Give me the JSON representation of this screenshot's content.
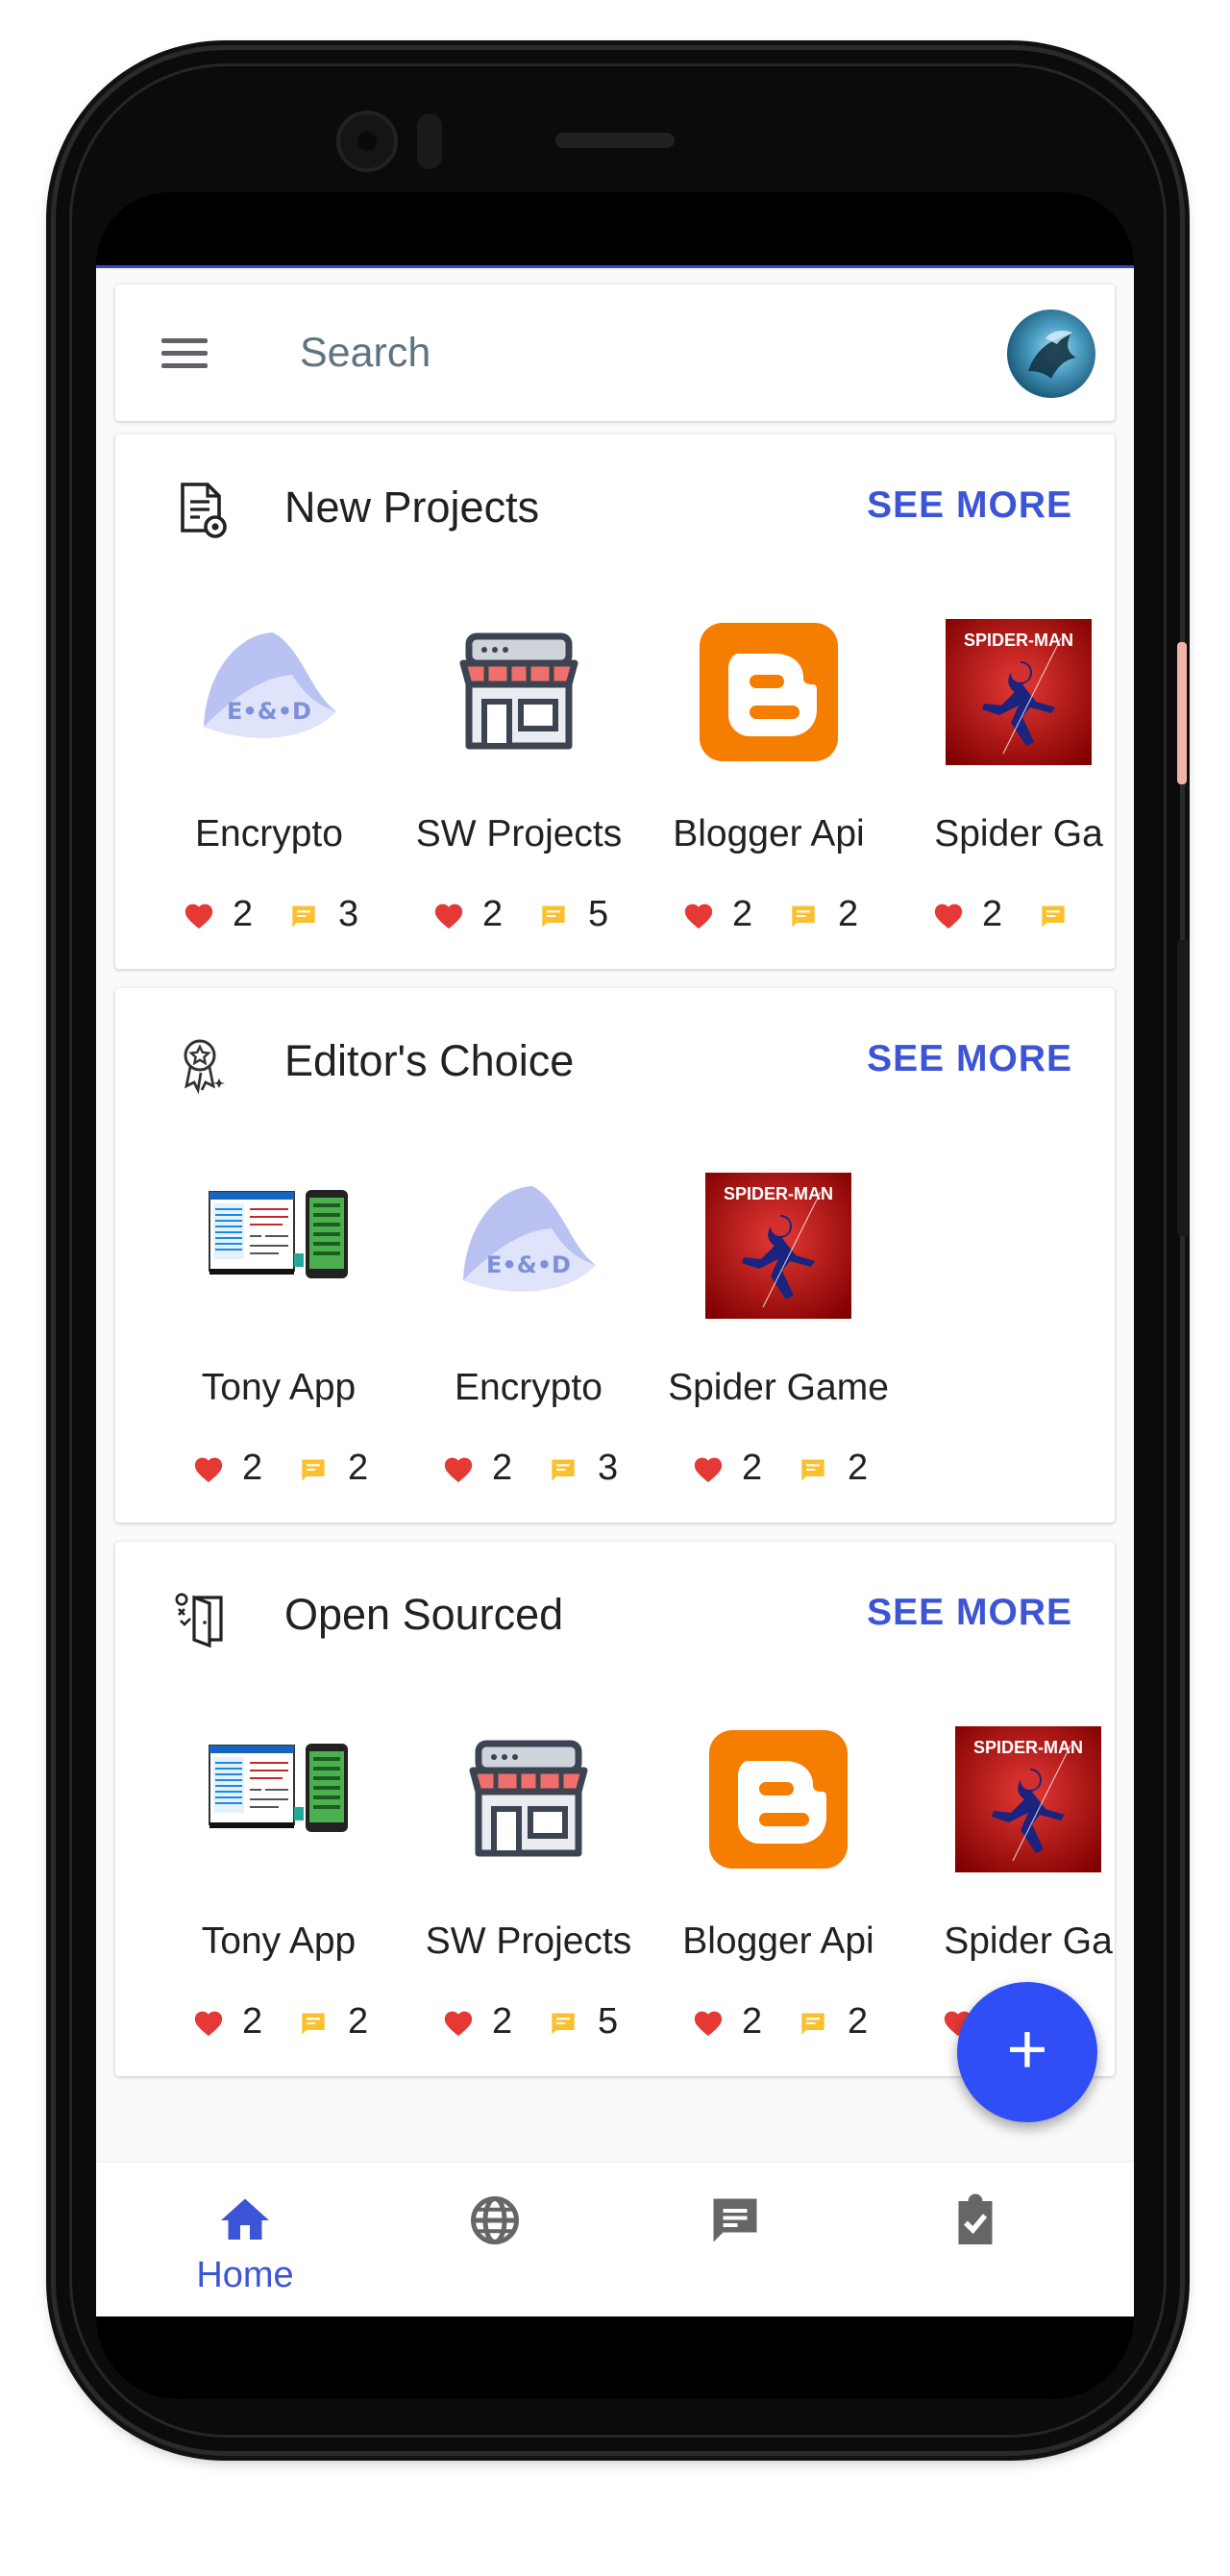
{
  "search": {
    "placeholder": "Search"
  },
  "sections": [
    {
      "title": "New Projects",
      "icon": "document-gear-icon",
      "see_more": "SEE MORE",
      "items": [
        {
          "name": "Encrypto",
          "likes": "2",
          "comments": "3",
          "image": "encrypto-logo"
        },
        {
          "name": "SW Projects",
          "likes": "2",
          "comments": "5",
          "image": "store-icon"
        },
        {
          "name": "Blogger Api",
          "likes": "2",
          "comments": "2",
          "image": "blogger-logo"
        },
        {
          "name": "Spider Ga",
          "likes": "2",
          "comments": "",
          "image": "spiderman-cover"
        }
      ]
    },
    {
      "title": "Editor's Choice",
      "icon": "award-ribbon-icon",
      "see_more": "SEE MORE",
      "items": [
        {
          "name": "Tony App",
          "likes": "2",
          "comments": "2",
          "image": "app-screenshot"
        },
        {
          "name": "Encrypto",
          "likes": "2",
          "comments": "3",
          "image": "encrypto-logo"
        },
        {
          "name": "Spider Game",
          "likes": "2",
          "comments": "2",
          "image": "spiderman-cover"
        }
      ]
    },
    {
      "title": "Open Sourced",
      "icon": "open-door-icon",
      "see_more": "SEE MORE",
      "items": [
        {
          "name": "Tony App",
          "likes": "2",
          "comments": "2",
          "image": "app-screenshot"
        },
        {
          "name": "SW Projects",
          "likes": "2",
          "comments": "5",
          "image": "store-icon"
        },
        {
          "name": "Blogger Api",
          "likes": "2",
          "comments": "2",
          "image": "blogger-logo"
        },
        {
          "name": "Spider Ga",
          "likes": "",
          "comments": "",
          "image": "spiderman-cover"
        }
      ]
    }
  ],
  "fab": {
    "label": "+"
  },
  "bottom_nav": [
    {
      "label": "Home",
      "icon": "home-icon",
      "active": true
    },
    {
      "label": "",
      "icon": "globe-icon",
      "active": false
    },
    {
      "label": "",
      "icon": "chat-icon",
      "active": false
    },
    {
      "label": "",
      "icon": "clipboard-check-icon",
      "active": false
    }
  ],
  "colors": {
    "accent": "#3c55d6",
    "fab": "#2f4ef5",
    "heart": "#e53935",
    "comment": "#fbc02d",
    "blogger": "#f57d00",
    "spiderman_bg": "#c62828"
  }
}
